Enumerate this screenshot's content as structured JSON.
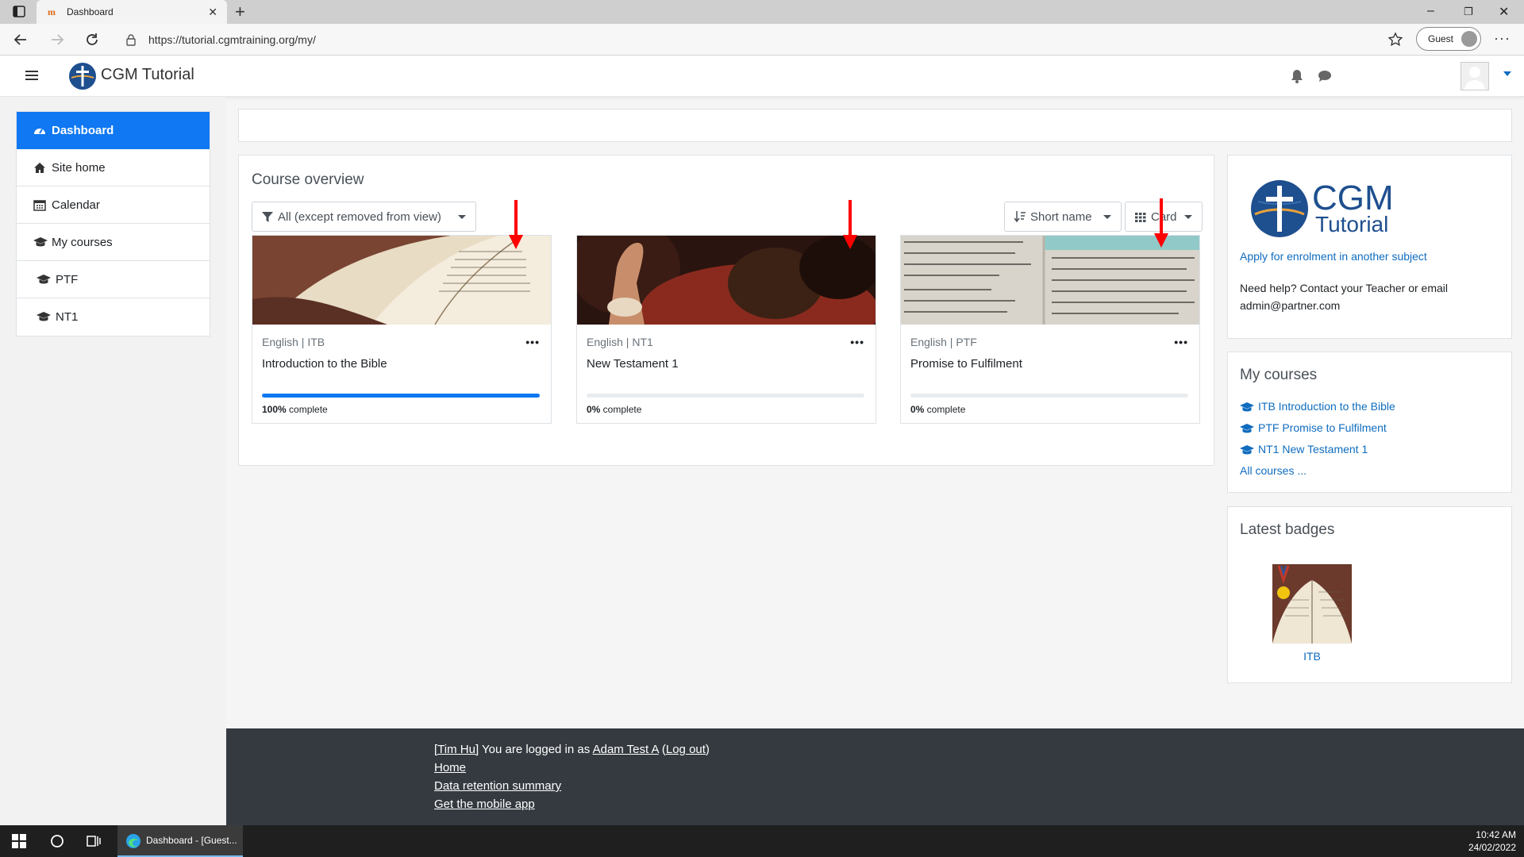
{
  "browser": {
    "tab_title": "Dashboard",
    "url": "https://tutorial.cgmtraining.org/my/",
    "profile_label": "Guest"
  },
  "site": {
    "name": "CGM Tutorial"
  },
  "drawer": {
    "items": [
      {
        "label": "Dashboard",
        "icon": "dashboard-icon",
        "active": true
      },
      {
        "label": "Site home",
        "icon": "home-icon"
      },
      {
        "label": "Calendar",
        "icon": "calendar-icon"
      },
      {
        "label": "My courses",
        "icon": "graduation-cap-icon"
      },
      {
        "label": "PTF",
        "icon": "graduation-cap-icon"
      },
      {
        "label": "NT1",
        "icon": "graduation-cap-icon"
      }
    ]
  },
  "overview": {
    "title": "Course overview",
    "filter_label": "All (except removed from view)",
    "sort_label": "Short name",
    "view_label": "Card",
    "courses": [
      {
        "meta": "English | ITB",
        "name": "Introduction to the Bible",
        "progress": 100,
        "progress_pct": "100%",
        "progress_suffix": " complete"
      },
      {
        "meta": "English | NT1",
        "name": "New Testament 1",
        "progress": 0,
        "progress_pct": "0%",
        "progress_suffix": " complete"
      },
      {
        "meta": "English | PTF",
        "name": "Promise to Fulfilment",
        "progress": 0,
        "progress_pct": "0%",
        "progress_suffix": " complete"
      }
    ]
  },
  "right": {
    "logo_line1": "CGM",
    "logo_line2": "Tutorial",
    "apply_link": "Apply for enrolment in another subject",
    "help_text": "Need help?  Contact your Teacher or email admin@partner.com",
    "mycourses_title": "My courses",
    "mycourses": [
      "ITB Introduction to the Bible",
      "PTF Promise to Fulfilment",
      "NT1 New Testament 1"
    ],
    "all_courses": "All courses ...",
    "badges_title": "Latest badges",
    "badge_name": "ITB"
  },
  "footer": {
    "user_bracket": "[Tim Hu]",
    "logged_in_text": " You are logged in as ",
    "user_name": "Adam Test A",
    "logout": "Log out",
    "home": "Home",
    "retention": "Data retention summary",
    "mobile": "Get the mobile app"
  },
  "taskbar": {
    "app_label": "Dashboard - [Guest...",
    "time": "10:42 AM",
    "date": "24/02/2022"
  },
  "colors": {
    "primary": "#0f78f2",
    "link": "#0f6cbf",
    "footer_bg": "#343a40",
    "annotation": "#ff0000"
  }
}
